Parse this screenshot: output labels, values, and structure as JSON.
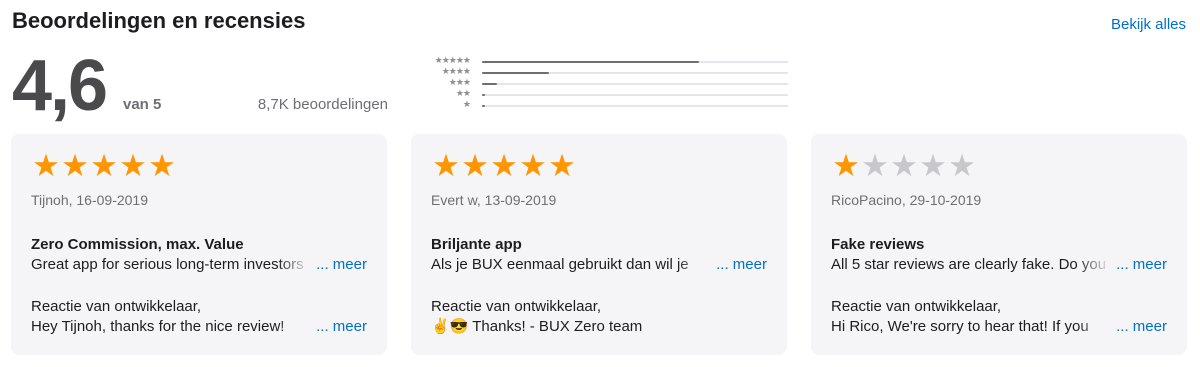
{
  "header": {
    "title": "Beoordelingen en recensies",
    "see_all": "Bekijk alles"
  },
  "summary": {
    "rating": "4,6",
    "out_of": "van 5",
    "count": "8,7K beoordelingen"
  },
  "histogram": [
    {
      "stars": "★★★★★",
      "fraction": 0.71
    },
    {
      "stars": "★★★★",
      "fraction": 0.22
    },
    {
      "stars": "★★★",
      "fraction": 0.05
    },
    {
      "stars": "★★",
      "fraction": 0.01
    },
    {
      "stars": "★",
      "fraction": 0.01
    }
  ],
  "colors": {
    "star_on": "#ff9500",
    "star_off": "#c7c7cc",
    "link": "#0070c9",
    "card_bg": "#f5f5f7"
  },
  "reviews": [
    {
      "rating": 5,
      "author_date": "Tijnoh, 16-09-2019",
      "title": "Zero Commission, max. Value",
      "body": "Great app for serious long-term investors",
      "more": "... meer",
      "dev_label": "Reactie van ontwikkelaar,",
      "dev_body": "Hey Tijnoh, thanks for the nice review!",
      "dev_more": "... meer"
    },
    {
      "rating": 5,
      "author_date": "Evert w, 13-09-2019",
      "title": "Briljante app",
      "body": "Als je BUX eenmaal gebruikt dan wil je",
      "more": "... meer",
      "dev_label": "Reactie van ontwikkelaar,",
      "dev_body": "✌😎 Thanks! - BUX Zero team",
      "dev_more": ""
    },
    {
      "rating": 1,
      "author_date": "RicoPacino, 29-10-2019",
      "title": "Fake reviews",
      "body": "All 5 star reviews are clearly fake. Do you",
      "more": "... meer",
      "dev_label": "Reactie van ontwikkelaar,",
      "dev_body": "Hi Rico, We're sorry to hear that! If you",
      "dev_more": "... meer"
    }
  ]
}
